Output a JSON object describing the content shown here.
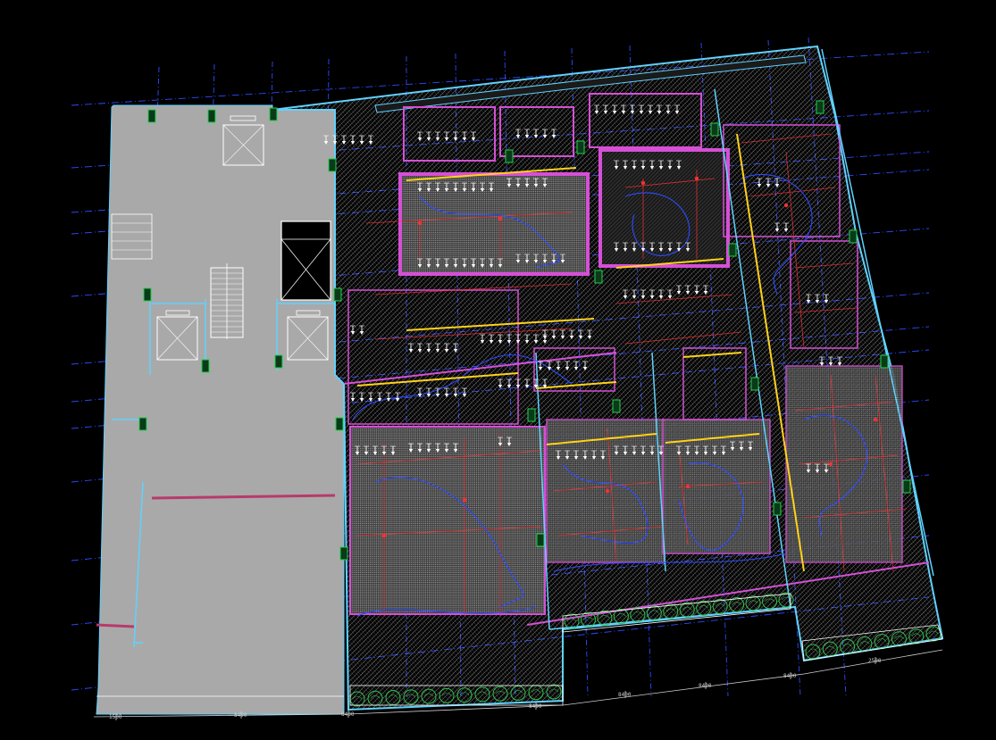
{
  "drawing": {
    "background": "#000000",
    "colors": {
      "grid": "#2c4bff",
      "wall_outline": "#5fd3ff",
      "partition": "#d64fd6",
      "service": "#ff3030",
      "highlight": "#ffd21a",
      "column": "#23d14a",
      "hatch": "#bdbdbd",
      "core_fill": "#a6a6a6",
      "white": "#ffffff"
    },
    "icons": {
      "stair": "stair-icon",
      "elevator": "elevator-icon",
      "shaft": "shaft-icon",
      "fixture": "fixture-arrow-icon",
      "tree": "planting-icon"
    },
    "bottom_dimension_labels": [
      "1500",
      "8400",
      "8400",
      "8400",
      "8400",
      "8400",
      "8400",
      "2500"
    ]
  }
}
